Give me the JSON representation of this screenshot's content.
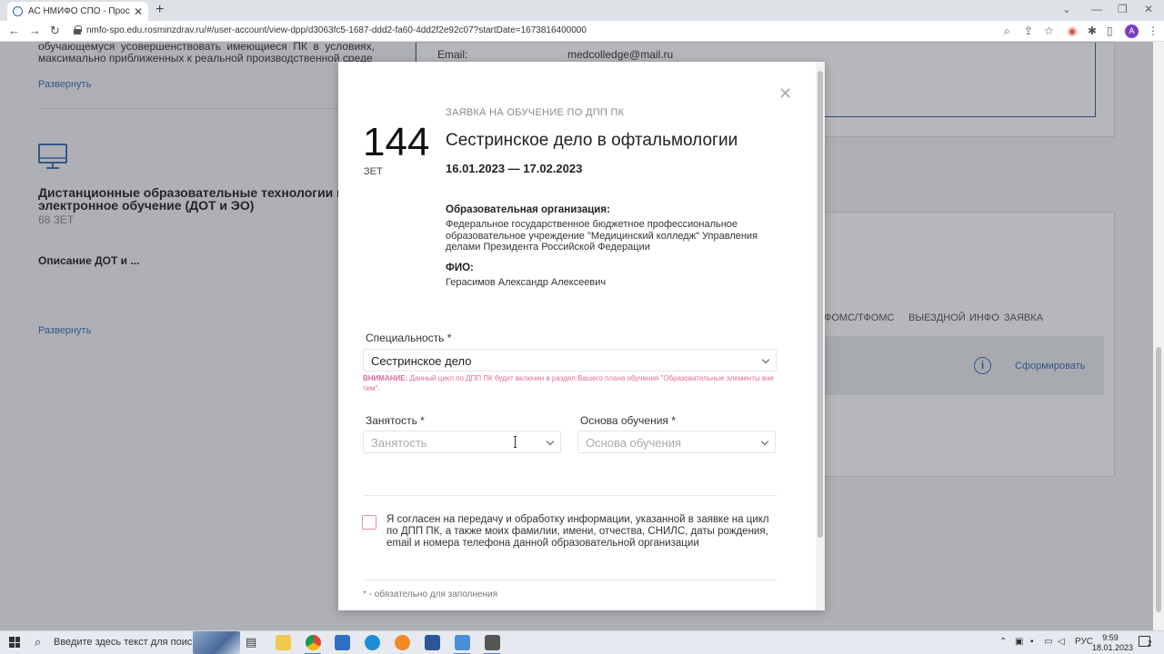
{
  "browser": {
    "tab_title": "АС НМИФО СПО - Просмотр Д",
    "url": "nmfo-spo.edu.rosminzdrav.ru/#/user-account/view-dpp/d3063fc5-1687-ddd2-fa60-4dd2f2e92c07?startDate=1673816400000"
  },
  "page": {
    "intro_text": "обучающемуся усовершенствовать имеющиеся ПК в условиях, максимально приближенных к реальной производственной среде",
    "expand_link_1": "Развернуть",
    "email_label": "Email:",
    "email_value": "medcolledge@mail.ru",
    "dot_title": "Дистанционные образовательные технологии и электронное обучение (ДОТ и ЭО)",
    "dot_zet": "68 ЗЕТ",
    "dot_desc": "Описание ДОТ и ...",
    "expand_link_2": "Развернуть",
    "tabs": [
      "ФОМС/ТФОМС",
      "ВЫЕЗДНОЙ",
      "ИНФО",
      "ЗАЯВКА"
    ],
    "generate_button": "Сформировать"
  },
  "modal": {
    "hours": "144",
    "zet_unit": "ЗЕТ",
    "kicker": "ЗАЯВКА НА ОБУЧЕНИЕ ПО ДПП ПК",
    "course_title": "Сестринское дело в офтальмологии",
    "dates": "16.01.2023 — 17.02.2023",
    "org_label": "Образовательная организация:",
    "org_value": "Федеральное государственное бюджетное профессиональное образовательное учреждение \"Медицинский колледж\" Управления делами Президента Российской Федерации",
    "fio_label": "ФИО:",
    "fio_value": "Герасимов Александр Алексеевич",
    "specialty_label": "Специальность *",
    "specialty_value": "Сестринское дело",
    "warning_prefix": "ВНИМАНИЕ:",
    "warning_text": "Данный цикл по ДПП ПК будет включен в раздел Вашего плана обучения \"Образовательные элементы вне тем\".",
    "employment_label": "Занятость *",
    "employment_placeholder": "Занятость",
    "basis_label": "Основа обучения *",
    "basis_placeholder": "Основа обучения",
    "consent_text": "Я согласен на передачу и обработку информации, указанной в заявке на цикл по ДПП ПК, а также моих фамилии, имени, отчества, СНИЛС, даты рождения, email и номера телефона данной образовательной организации",
    "required_note": "* - обязательно для заполнения"
  },
  "taskbar": {
    "search_placeholder": "Введите здесь текст для поиска",
    "lang": "РУС",
    "time": "9:59",
    "date": "18.01.2023",
    "notification_count": "2"
  },
  "colors": {
    "accent_link": "#3a6cb5",
    "warning_pink": "#e06b9c"
  }
}
